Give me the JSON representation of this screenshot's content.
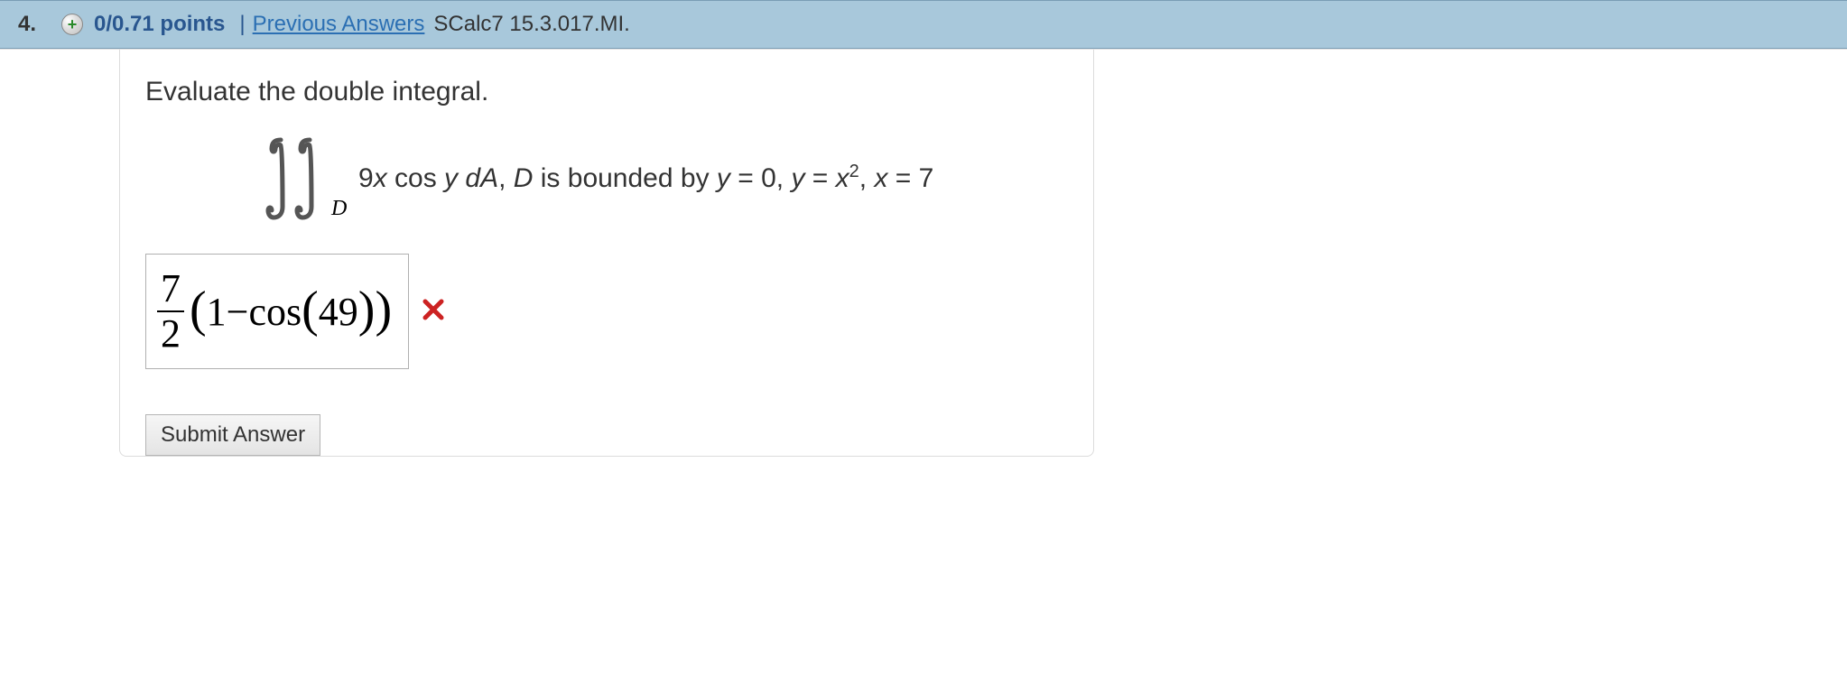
{
  "header": {
    "question_number": "4.",
    "points": "0/0.71 points",
    "divider": "|",
    "previous_answers": "Previous Answers",
    "problem_code": "SCalc7 15.3.017.MI."
  },
  "question": {
    "prompt": "Evaluate the double integral.",
    "integral_sub": "D",
    "integrand_prefix": "9",
    "integrand_x": "x",
    "integrand_cos": " cos ",
    "integrand_y": "y",
    "integrand_dA": " dA",
    "integrand_comma": ", ",
    "region_text": "D is bounded by y = 0, y = x",
    "region_sup": "2",
    "region_tail": ", x = 7"
  },
  "answer": {
    "frac_num": "7",
    "frac_den": "2",
    "open_paren": "(",
    "one": "1",
    "minus": " − ",
    "cos": "cos",
    "inner_open": "(",
    "value": "49",
    "inner_close": ")",
    "close_paren": ")"
  },
  "buttons": {
    "submit": "Submit Answer"
  }
}
